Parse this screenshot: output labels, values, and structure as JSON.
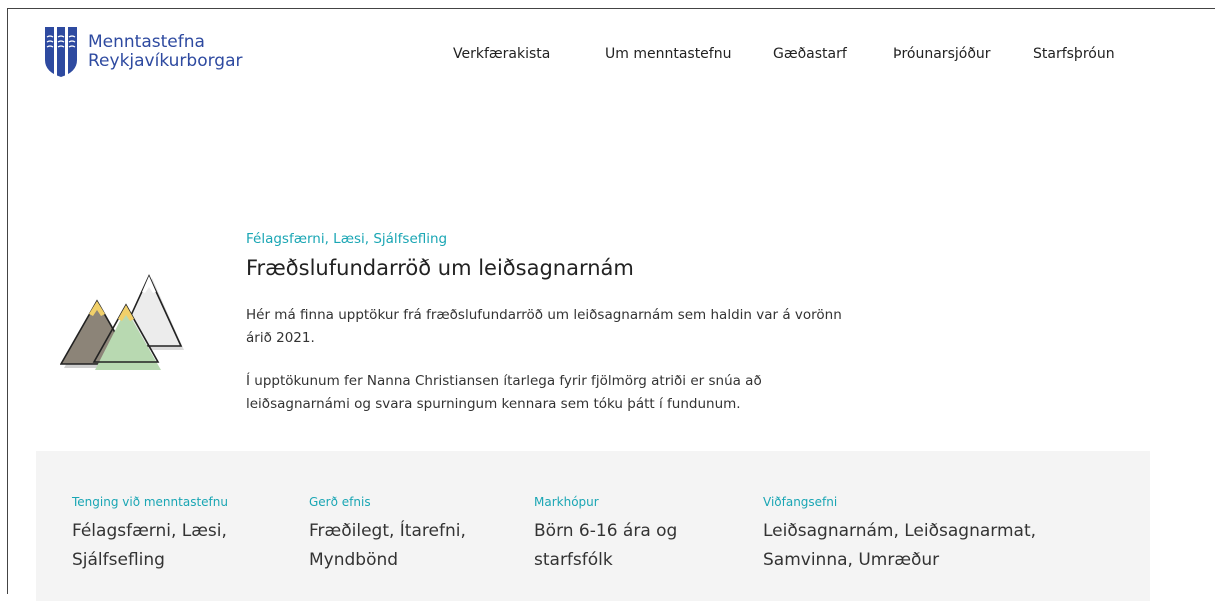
{
  "header": {
    "logo_line1": "Menntastefna",
    "logo_line2": "Reykjavíkurborgar",
    "nav": [
      "Verkfærakista",
      "Um menntastefnu",
      "Gæðastarf",
      "Þróunarsjóður",
      "Starfsþróun"
    ]
  },
  "article": {
    "tags": "Félagsfærni, Læsi, Sjálfsefling",
    "title": "Fræðslufundarröð um leiðsagnarnám",
    "paragraph1_line1": "Hér má finna upptökur frá fræðslufundarröð um leiðsagnarnám sem haldin var á vorönn",
    "paragraph1_line2": "árið 2021.",
    "paragraph2_line1": "Í upptökunum fer Nanna Christiansen ítarlega fyrir fjölmörg atriði er snúa að",
    "paragraph2_line2": "leiðsagnarnámi og svara spurningum kennara sem tóku þátt í fundunum."
  },
  "meta": [
    {
      "label": "Tenging við menntastefnu",
      "line1": "Félagsfærni, Læsi,",
      "line2": "Sjálfsefling"
    },
    {
      "label": "Gerð efnis",
      "line1": "Fræðilegt, Ítarefni,",
      "line2": "Myndbönd"
    },
    {
      "label": "Markhópur",
      "line1": "Börn 6-16 ára og",
      "line2": "starfsfólk"
    },
    {
      "label": "Viðfangsefni",
      "line1": "Leiðsagnarnám, Leiðsagnarmat,",
      "line2": "Samvinna, Umræður"
    }
  ],
  "colors": {
    "accent": "#1aa6b4",
    "brand_blue": "#2e4aa0",
    "panel_bg": "#f4f4f4"
  },
  "icons": {
    "logo": "reykjavik-shield-icon",
    "illustration": "mountains-illustration"
  }
}
